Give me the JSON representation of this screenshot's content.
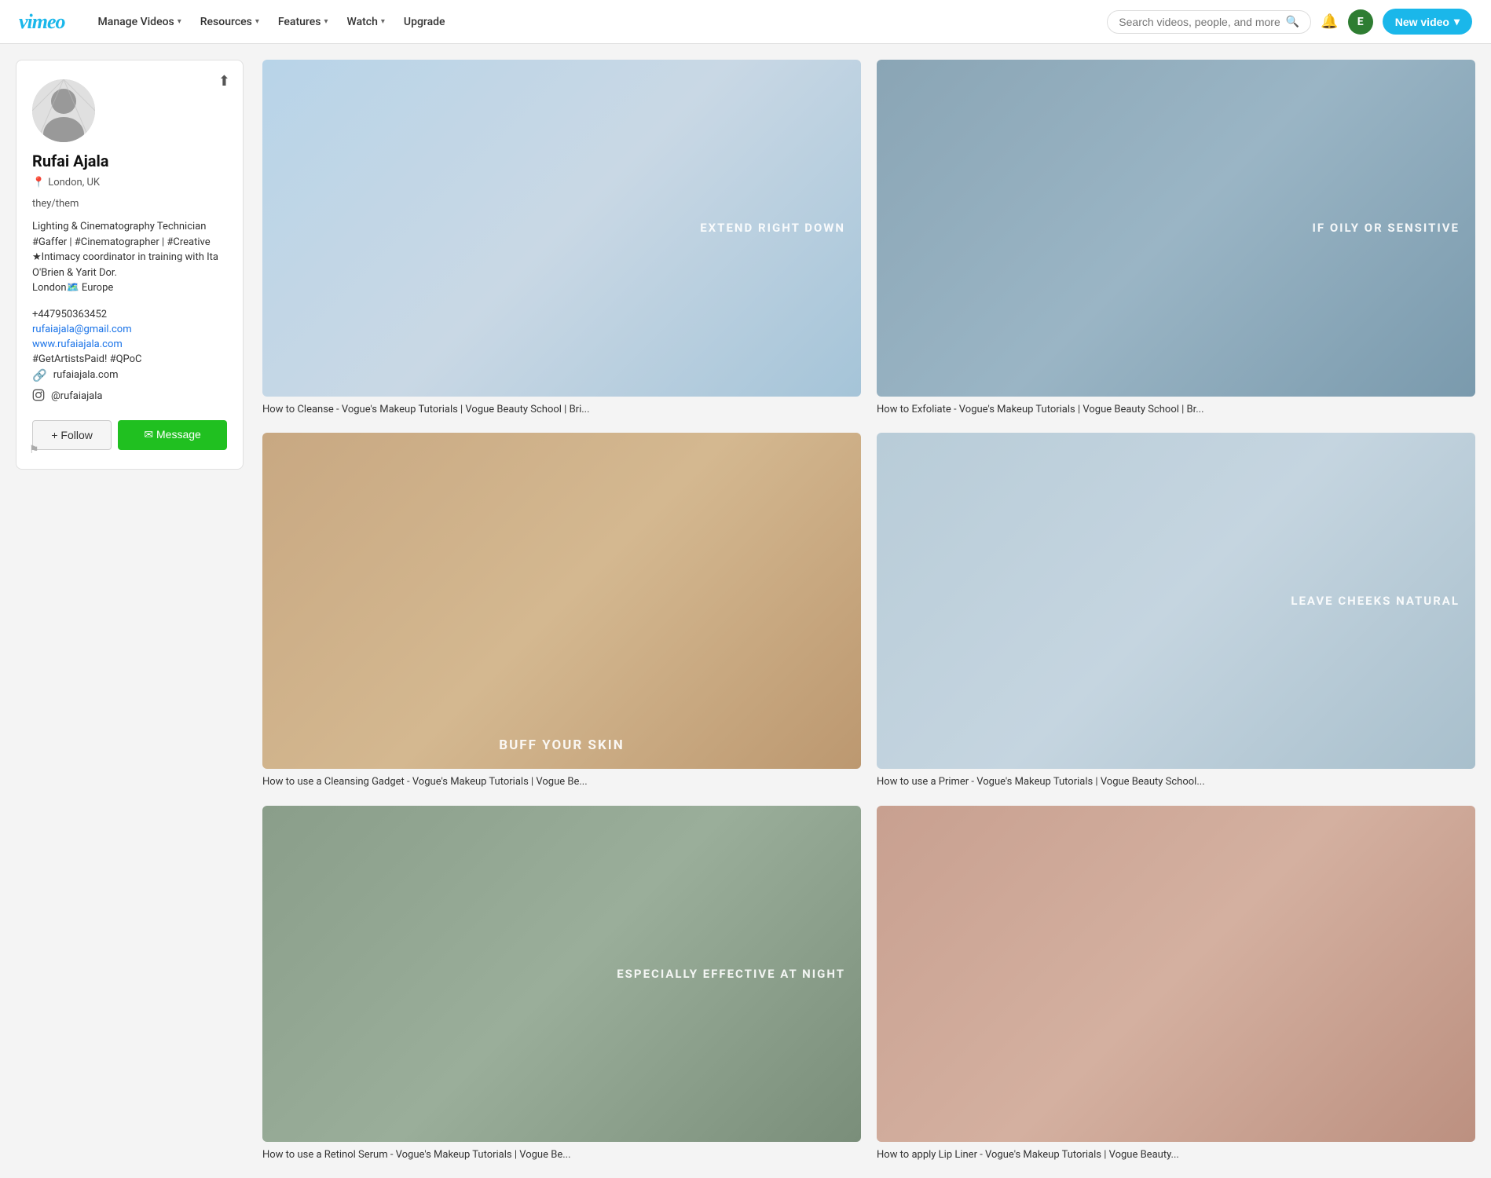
{
  "header": {
    "logo": "vimeo",
    "nav": [
      {
        "label": "Manage Videos",
        "hasDropdown": true
      },
      {
        "label": "Resources",
        "hasDropdown": true
      },
      {
        "label": "Features",
        "hasDropdown": true
      },
      {
        "label": "Watch",
        "hasDropdown": true
      },
      {
        "label": "Upgrade",
        "hasDropdown": false
      }
    ],
    "search": {
      "placeholder": "Search videos, people, and more"
    },
    "avatar_initial": "E",
    "new_video_label": "New video"
  },
  "profile": {
    "name": "Rufai Ajala",
    "location": "London, UK",
    "pronouns": "they/them",
    "bio_line1": "Lighting & Cinematography Technician",
    "bio_line2": "#Gaffer | #Cinematographer | #Creative",
    "bio_line3": "★Intimacy coordinator in training with Ita O'Brien & Yarit Dor.",
    "bio_line4": "London🗺️ Europe",
    "phone": "+447950363452",
    "email": "rufaiajala@gmail.com",
    "website": "www.rufaiajala.com",
    "hashtags": "#GetArtistsPaid! #QPoC",
    "link_url": "rufaiajala.com",
    "instagram": "@rufaiajala",
    "follow_label": "+ Follow",
    "message_label": "✉ Message"
  },
  "videos": [
    {
      "title": "How to Cleanse - Vogue's Makeup Tutorials | Vogue Beauty School | Bri...",
      "thumb_text": "EXTEND\nRIGHT\nDOWN",
      "thumb_class": "thumb-1"
    },
    {
      "title": "How to Exfoliate - Vogue's Makeup Tutorials | Vogue Beauty School | Br...",
      "thumb_text": "IF OILY OR\nSENSITIVE",
      "thumb_class": "thumb-2"
    },
    {
      "title": "How to use a Cleansing Gadget - Vogue's Makeup Tutorials | Vogue Be...",
      "thumb_text": "BUFF YOUR SKIN",
      "thumb_class": "thumb-3",
      "text_position": "bottom"
    },
    {
      "title": "How to use a Primer - Vogue's Makeup Tutorials | Vogue Beauty School...",
      "thumb_text": "LEAVE\nCHEEKS\nNATURAL",
      "thumb_class": "thumb-4"
    },
    {
      "title": "How to use a Retinol Serum - Vogue's Makeup Tutorials | Vogue Be...",
      "thumb_text": "ESPECIALLY\nEFFECTIVE\nAT NIGHT",
      "thumb_class": "thumb-5"
    },
    {
      "title": "How to apply Lip Liner - Vogue's Makeup Tutorials | Vogue Beauty...",
      "thumb_text": "",
      "thumb_class": "thumb-6"
    }
  ]
}
